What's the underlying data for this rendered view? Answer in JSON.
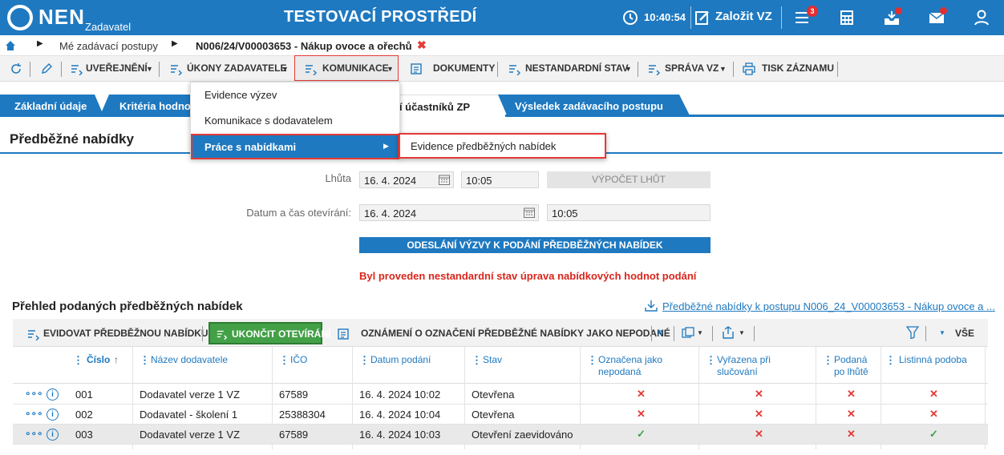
{
  "header": {
    "logo_text": "NEN",
    "logo_sub": "Zadavatel",
    "environment": "TESTOVACÍ PROSTŘEDÍ",
    "time": "10:40:54",
    "create_label": "Založit VZ",
    "menu_badge": "3",
    "icons": [
      "clock-icon",
      "edit-icon",
      "menu-icon",
      "calculator-icon",
      "inbox-icon",
      "mail-icon",
      "user-icon"
    ]
  },
  "breadcrumb": {
    "item1": "Mé zadávací postupy",
    "item2": "N006/24/V00003653 - Nákup ovoce a ořechů"
  },
  "toolbar": {
    "uverejneni": "UVEŘEJNĚNÍ",
    "ukony": "ÚKONY ZADAVATELE",
    "komunikace": "KOMUNIKACE",
    "dokumenty": "DOKUMENTY",
    "nestandardni": "NESTANDARDNÍ STAV",
    "sprava": "SPRÁVA VZ",
    "tisk": "TISK ZÁZNAMU"
  },
  "tabs": {
    "t1": "Základní údaje",
    "t2": "Kritéria hodno",
    "t3": "ní účastníků ZP",
    "t4": "Výsledek zadávacího postupu"
  },
  "menu": {
    "item1": "Evidence výzev",
    "item2": "Komunikace s dodavatelem",
    "item3": "Práce s nabídkami",
    "sub1": "Evidence předběžných nabídek"
  },
  "section": {
    "title": "Předběžné nabídky",
    "lhuta_label": "Lhůta",
    "lhuta_date": "16. 4. 2024",
    "lhuta_time": "10:05",
    "vypocet": "VÝPOČET LHŮT",
    "otevirani_label": "Datum a čas otevírání:",
    "otevirani_date": "16. 4. 2024",
    "otevirani_time": "10:05",
    "odeslani": "ODESLÁNÍ VÝZVY K PODÁNÍ PŘEDBĚŽNÝCH NABÍDEK",
    "warning": "Byl proveden nestandardní stav úprava nabídkových hodnot podání"
  },
  "grid_section": {
    "title": "Přehled podaných předběžných nabídek",
    "link": "Předběžné nabídky k postupu N006_24_V00003653 - Nákup ovoce a ...",
    "evidovat": "EVIDOVAT PŘEDBĚŽNOU NABÍDKU",
    "ukoncit": "UKONČIT OTEVÍRÁNÍ",
    "oznameni": "OZNÁMENÍ O OZNAČENÍ PŘEDBĚŽNÉ NABÍDKY JAKO NEPODANÉ",
    "vse": "VŠE"
  },
  "table": {
    "headers": {
      "cislo": "Číslo",
      "nazev": "Název dodavatele",
      "ico": "IČO",
      "datum": "Datum podání",
      "stav": "Stav",
      "oznacena1": "Označena jako",
      "oznacena2": "nepodaná",
      "vyrazena1": "Vyřazena při",
      "vyrazena2": "slučování",
      "podana1": "Podaná",
      "podana2": "po lhůtě",
      "listinna": "Listinná podoba"
    },
    "rows": [
      {
        "cislo": "001",
        "nazev": "Dodavatel verze 1 VZ",
        "ico": "67589",
        "datum": "16. 4. 2024 10:02",
        "stav": "Otevřena",
        "oznacena": "✕",
        "vyrazena": "✕",
        "podana": "✕",
        "listinna": "✕"
      },
      {
        "cislo": "002",
        "nazev": "Dodavatel - školení 1",
        "ico": "25388304",
        "datum": "16. 4. 2024 10:04",
        "stav": "Otevřena",
        "oznacena": "✕",
        "vyrazena": "✕",
        "podana": "✕",
        "listinna": "✕"
      },
      {
        "cislo": "003",
        "nazev": "Dodavatel verze 1 VZ",
        "ico": "67589",
        "datum": "16. 4. 2024 10:03",
        "stav": "Otevření zaevidováno",
        "oznacena": "✓",
        "vyrazena": "✕",
        "podana": "✕",
        "listinna": "✓"
      }
    ]
  },
  "colors": {
    "brand": "#1e79c0",
    "alert": "#e53935",
    "success": "#43a047",
    "action_green": "#43a047"
  }
}
